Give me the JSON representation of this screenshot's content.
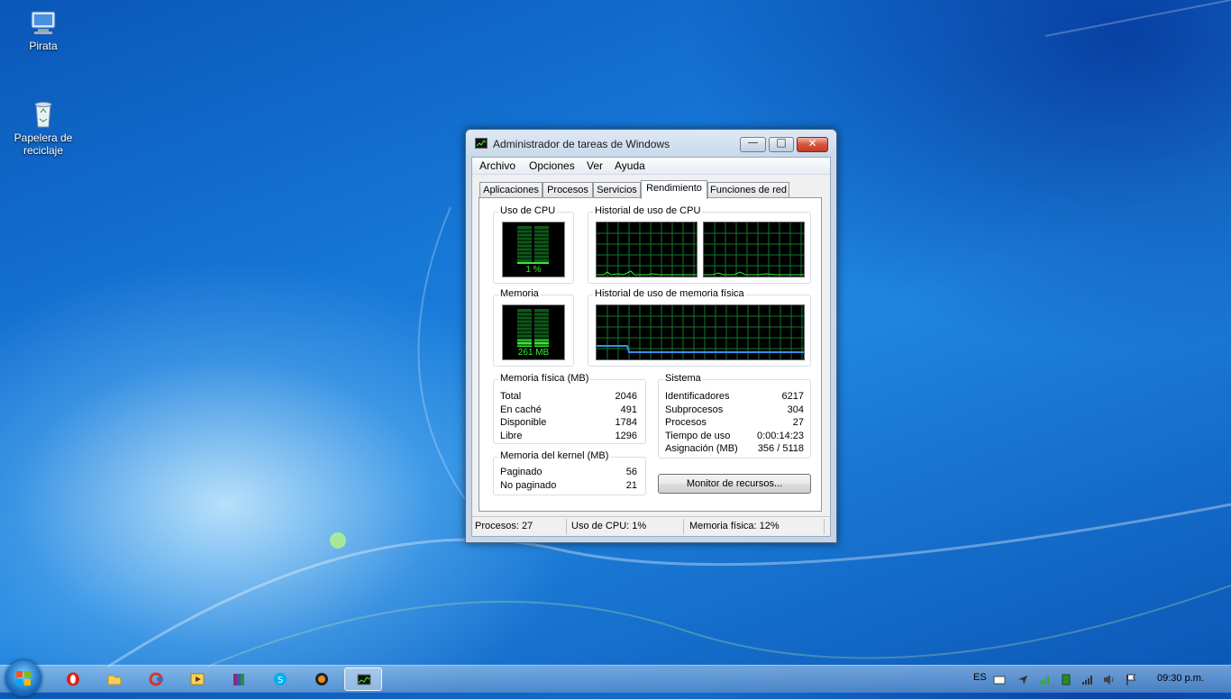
{
  "desktop": {
    "icons": [
      {
        "label": "Pirata"
      },
      {
        "label_line1": "Papelera de",
        "label_line2": "reciclaje"
      }
    ]
  },
  "window": {
    "title": "Administrador de tareas de Windows",
    "menu": [
      "Archivo",
      "Opciones",
      "Ver",
      "Ayuda"
    ],
    "tabs": [
      "Aplicaciones",
      "Procesos",
      "Servicios",
      "Rendimiento",
      "Funciones de red"
    ],
    "active_tab": "Rendimiento",
    "cpu_usage": {
      "label": "Uso de CPU",
      "value": "1 %"
    },
    "cpu_history": {
      "label": "Historial de uso de CPU"
    },
    "memory": {
      "label": "Memoria",
      "value": "261 MB"
    },
    "memory_history": {
      "label": "Historial de uso de memoria física"
    },
    "physical_memory": {
      "label": "Memoria física (MB)",
      "rows": [
        {
          "k": "Total",
          "v": "2046"
        },
        {
          "k": "En caché",
          "v": "491"
        },
        {
          "k": "Disponible",
          "v": "1784"
        },
        {
          "k": "Libre",
          "v": "1296"
        }
      ]
    },
    "kernel_memory": {
      "label": "Memoria del kernel (MB)",
      "rows": [
        {
          "k": "Paginado",
          "v": "56"
        },
        {
          "k": "No paginado",
          "v": "21"
        }
      ]
    },
    "system": {
      "label": "Sistema",
      "rows": [
        {
          "k": "Identificadores",
          "v": "6217"
        },
        {
          "k": "Subprocesos",
          "v": "304"
        },
        {
          "k": "Procesos",
          "v": "27"
        },
        {
          "k": "Tiempo de uso",
          "v": "0:00:14:23"
        },
        {
          "k": "Asignación (MB)",
          "v": "356 / 5118"
        }
      ]
    },
    "resource_monitor_button": "Monitor de recursos...",
    "status": {
      "processes": "Procesos: 27",
      "cpu": "Uso de CPU: 1%",
      "memory": "Memoria física: 12%"
    }
  },
  "taskbar": {
    "apps": [
      "opera-icon",
      "explorer-icon",
      "ccleaner-icon",
      "media-player-icon",
      "winrar-icon",
      "skype-icon",
      "media-app-icon",
      "task-manager-icon"
    ],
    "language": "ES",
    "clock": "09:30 p.m."
  },
  "colors": {
    "graph_green": "#38e838",
    "grid": "#0b7a2e",
    "memory_line": "#3a8ee8"
  }
}
